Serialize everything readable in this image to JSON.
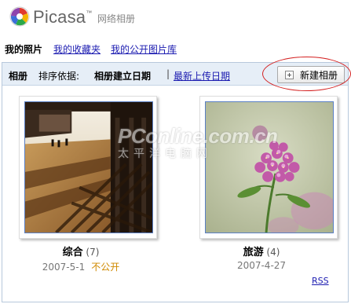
{
  "header": {
    "brand": "Picasa",
    "trademark": "™",
    "subtitle": "网络相册",
    "logo_icon": "picasa-pinwheel-icon"
  },
  "nav": {
    "current": "我的照片",
    "links": [
      "我的收藏夹",
      "我的公开图片库"
    ]
  },
  "toolbar": {
    "label": "相册",
    "sort_prefix": "排序依据:",
    "sort_current": "相册建立日期",
    "separator": "|",
    "sort_other": "最新上传日期",
    "new_album": "新建相册",
    "new_album_icon": "add-album-icon"
  },
  "albums": [
    {
      "title": "综合",
      "count": "(7)",
      "date": "2007-5-1",
      "visibility": "不公开"
    },
    {
      "title": "旅游",
      "count": "(4)",
      "date": "2007-4-27",
      "visibility": ""
    }
  ],
  "footer": {
    "rss": "RSS"
  },
  "watermark": {
    "line1": "PConline.com.cn",
    "line2": "太平洋电脑网"
  },
  "colors": {
    "link": "#1a1ab0",
    "toolbar_bg": "#e6eef7",
    "highlight_oval": "#d42020",
    "private": "#d08a00"
  }
}
